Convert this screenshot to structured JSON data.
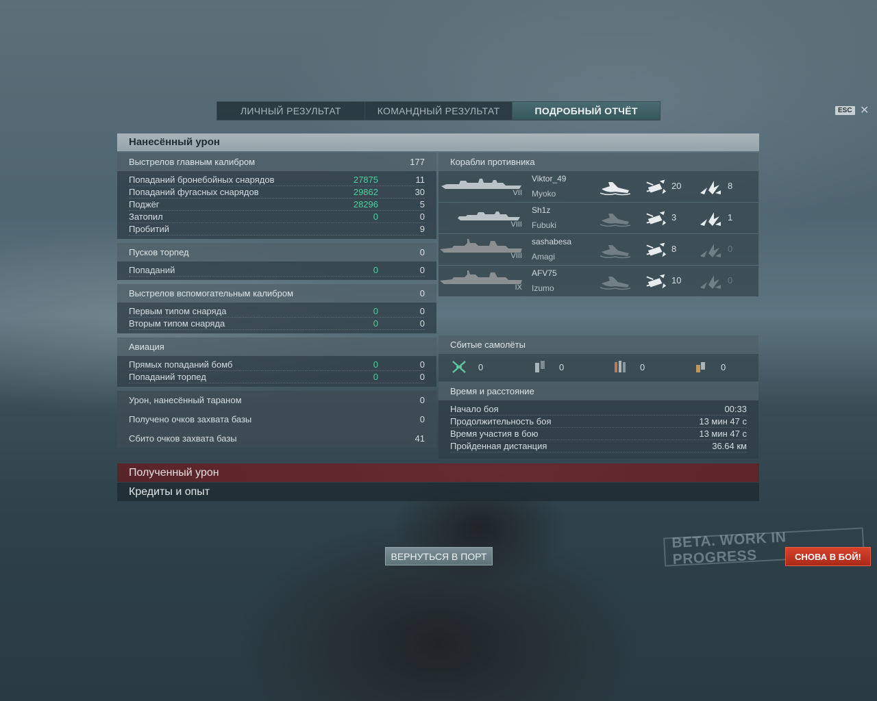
{
  "tabs": [
    "ЛИЧНЫЙ РЕЗУЛЬТАТ",
    "КОМАНДНЫЙ РЕЗУЛЬТАТ",
    "ПОДРОБНЫЙ ОТЧЁТ"
  ],
  "active_tab": "ПОДРОБНЫЙ ОТЧЁТ",
  "esc_label": "ESC",
  "close_glyph": "✕",
  "damage_title": "Нанесённый урон",
  "left": {
    "main_battery": {
      "label": "Выстрелов главным калибром",
      "value": "177",
      "rows": [
        {
          "label": "Попаданий бронебойных снарядов",
          "green": "27875",
          "value": "11"
        },
        {
          "label": "Попаданий фугасных снарядов",
          "green": "29862",
          "value": "30"
        },
        {
          "label": "Поджёг",
          "green": "28296",
          "value": "5"
        },
        {
          "label": "Затопил",
          "green": "0",
          "value": "0"
        },
        {
          "label": "Пробитий",
          "green": "",
          "value": "9"
        }
      ]
    },
    "torpedoes": {
      "label": "Пусков торпед",
      "value": "0",
      "rows": [
        {
          "label": "Попаданий",
          "green": "0",
          "value": "0"
        }
      ]
    },
    "secondary": {
      "label": "Выстрелов вспомогательным калибром",
      "value": "0",
      "rows": [
        {
          "label": "Первым типом снаряда",
          "green": "0",
          "value": "0"
        },
        {
          "label": "Вторым типом снаряда",
          "green": "0",
          "value": "0"
        }
      ]
    },
    "aviation": {
      "label": "Авиация",
      "value": "",
      "rows": [
        {
          "label": "Прямых попаданий бомб",
          "green": "0",
          "value": "0"
        },
        {
          "label": "Попаданий торпед",
          "green": "0",
          "value": "0"
        }
      ]
    },
    "ram": {
      "label": "Урон, нанесённый тараном",
      "value": "0"
    },
    "capture_gained": {
      "label": "Получено очков захвата базы",
      "value": "0"
    },
    "capture_reset": {
      "label": "Сбито очков захвата базы",
      "value": "41"
    }
  },
  "enemies": {
    "title": "Корабли противника",
    "ships": [
      {
        "player": "Viktor_49",
        "ship": "Myoko",
        "tier": "VII",
        "kind": "cruiser",
        "sunk": true,
        "hits": "20",
        "fires": "8",
        "fires_active": true
      },
      {
        "player": "Sh1z",
        "ship": "Fubuki",
        "tier": "VIII",
        "kind": "destroyer",
        "sunk": false,
        "hits": "3",
        "fires": "1",
        "fires_active": true
      },
      {
        "player": "sashabesa",
        "ship": "Amagi",
        "tier": "VIII",
        "kind": "battleship",
        "sunk": false,
        "hits": "8",
        "fires": "0",
        "fires_active": false
      },
      {
        "player": "AFV75",
        "ship": "Izumo",
        "tier": "IX",
        "kind": "battleship",
        "sunk": false,
        "hits": "10",
        "fires": "0",
        "fires_active": false
      }
    ]
  },
  "planes": {
    "title": "Сбитые самолёты",
    "items": [
      {
        "icon": "fighter-plane-icon",
        "value": "0"
      },
      {
        "icon": "torpedo-bomber-icon",
        "value": "0"
      },
      {
        "icon": "dive-bomber-icon",
        "value": "0"
      },
      {
        "icon": "spotter-plane-icon",
        "value": "0"
      }
    ]
  },
  "time": {
    "title": "Время и расстояние",
    "rows": [
      {
        "label": "Начало боя",
        "value": "00:33"
      },
      {
        "label": "Продолжительность боя",
        "value": "13 мин 47 с"
      },
      {
        "label": "Время участия в бою",
        "value": "13 мин 47 с"
      },
      {
        "label": "Пройденная дистанция",
        "value": "36.64 км"
      }
    ]
  },
  "received_damage": "Полученный урон",
  "credits_xp": "Кредиты и опыт",
  "return_port": "ВЕРНУТЬСЯ В ПОРТ",
  "watermark": "BETA. WORK IN PROGRESS",
  "battle_again": "СНОВА В БОЙ!",
  "colors": {
    "green": "#4fd0a0",
    "red_button": "#c4331f",
    "active_tab": "#3f6166"
  }
}
